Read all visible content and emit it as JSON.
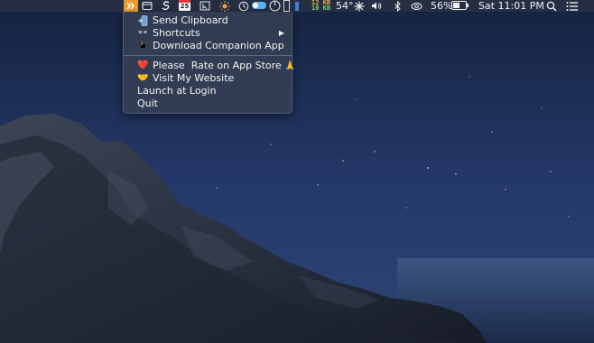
{
  "menubar": {
    "net_up": "12 KB",
    "net_down": "10 KB",
    "temperature": "54°",
    "battery_percent": "56%",
    "clock": "Sat 11:01 PM",
    "calendar_day": "25",
    "battery_level": 0.56,
    "icons": [
      "shortcuts-app-icon",
      "window-icon",
      "s-app-icon",
      "calendar-icon",
      "cursor-icon",
      "brightness-icon",
      "clock-app-icon",
      "toggle-icon",
      "power-icon",
      "memory-bar-icon",
      "fan-icon",
      "volume-icon",
      "bluetooth-icon",
      "sync-icon",
      "battery-icon",
      "search-icon",
      "control-center-icon"
    ]
  },
  "dropdown": {
    "items": [
      {
        "label": "Send Clipboard",
        "icon": "phone-send-icon"
      },
      {
        "label": "Shortcuts",
        "icon": "glasses-icon",
        "has_submenu": true
      },
      {
        "label": "Download Companion App",
        "icon": "mobile-phone-icon"
      },
      {
        "label": "Please  Rate on App Store",
        "icon": "heart-icon",
        "trailing_icon": "folded-hands-icon"
      },
      {
        "label": "Visit My Website",
        "icon": "handshake-icon"
      },
      {
        "label": "Launch at Login"
      },
      {
        "label": "Quit"
      }
    ],
    "glyphs": {
      "heart": "❤️",
      "hands": "🙏",
      "handshake": "🤝",
      "glasses": "👓",
      "phone": "📱",
      "arrow": "▶"
    }
  },
  "colors": {
    "accent": "#e89a2c",
    "menubar_bg": "#283044",
    "menu_bg": "#343e54"
  }
}
